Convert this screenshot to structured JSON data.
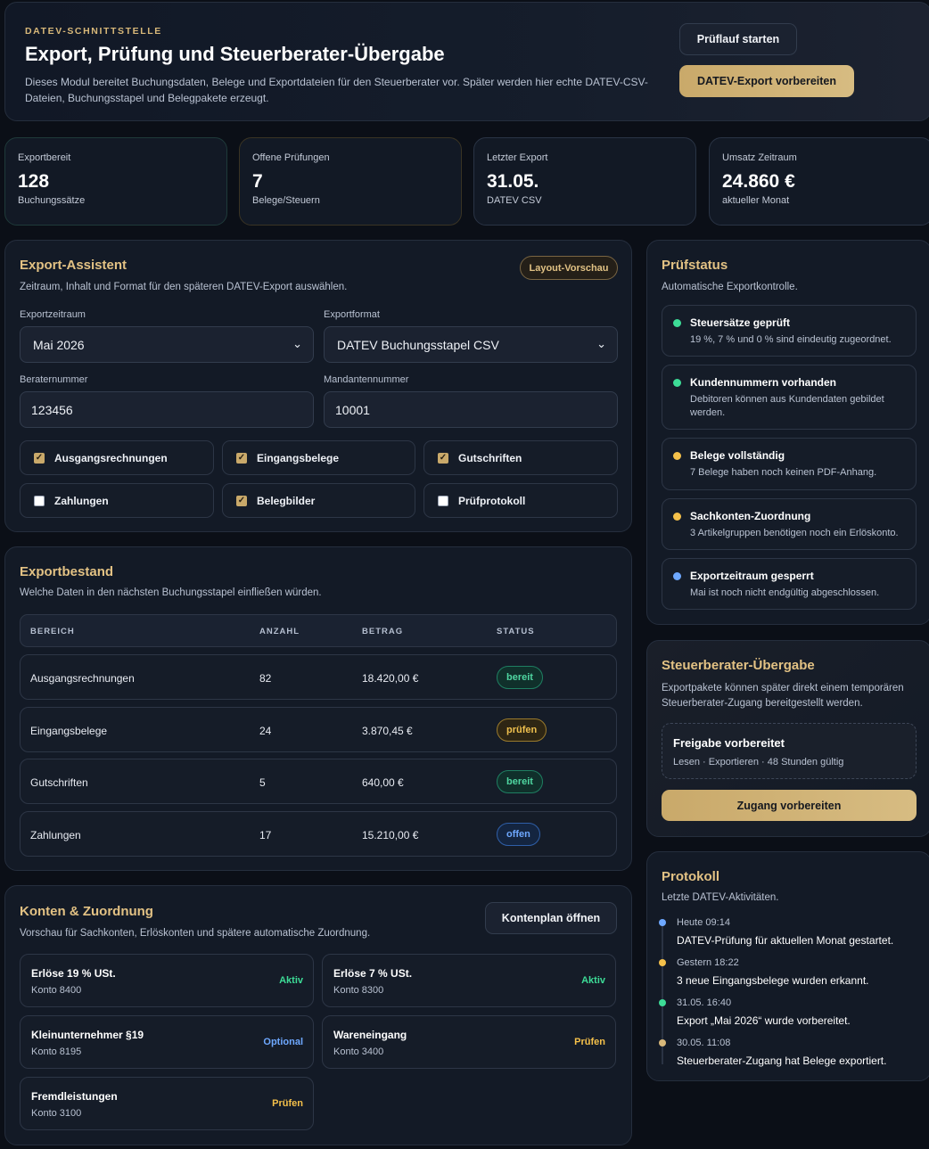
{
  "header": {
    "kicker": "DATEV-SCHNITTSTELLE",
    "title": "Export, Prüfung und Steuerberater-Übergabe",
    "description": "Dieses Modul bereitet Buchungsdaten, Belege und Exportdateien für den Steuerberater vor. Später werden hier echte DATEV-CSV-Dateien, Buchungsstapel und Belegpakete erzeugt.",
    "check_button": "Prüflauf starten",
    "export_button": "DATEV-Export vorbereiten"
  },
  "stats": [
    {
      "label": "Exportbereit",
      "value": "128",
      "sub": "Buchungssätze"
    },
    {
      "label": "Offene Prüfungen",
      "value": "7",
      "sub": "Belege/Steuern"
    },
    {
      "label": "Letzter Export",
      "value": "31.05.",
      "sub": "DATEV CSV"
    },
    {
      "label": "Umsatz Zeitraum",
      "value": "24.860 €",
      "sub": "aktueller Monat"
    }
  ],
  "assistant": {
    "title": "Export-Assistent",
    "subtitle": "Zeitraum, Inhalt und Format für den späteren DATEV-Export auswählen.",
    "badge": "Layout-Vorschau",
    "period_label": "Exportzeitraum",
    "period_value": "Mai 2026",
    "format_label": "Exportformat",
    "format_value": "DATEV Buchungsstapel CSV",
    "advisor_label": "Beraternummer",
    "advisor_value": "123456",
    "client_label": "Mandantennummer",
    "client_value": "10001",
    "options": [
      {
        "label": "Ausgangsrechnungen",
        "checked": true
      },
      {
        "label": "Eingangsbelege",
        "checked": true
      },
      {
        "label": "Gutschriften",
        "checked": true
      },
      {
        "label": "Zahlungen",
        "checked": false
      },
      {
        "label": "Belegbilder",
        "checked": true
      },
      {
        "label": "Prüfprotokoll",
        "checked": false
      }
    ]
  },
  "inventory": {
    "title": "Exportbestand",
    "subtitle": "Welche Daten in den nächsten Buchungsstapel einfließen würden.",
    "columns": [
      "BEREICH",
      "ANZAHL",
      "BETRAG",
      "STATUS"
    ],
    "rows": [
      {
        "area": "Ausgangsrechnungen",
        "count": "82",
        "amount": "18.420,00 €",
        "status": "bereit"
      },
      {
        "area": "Eingangsbelege",
        "count": "24",
        "amount": "3.870,45 €",
        "status": "prüfen"
      },
      {
        "area": "Gutschriften",
        "count": "5",
        "amount": "640,00 €",
        "status": "bereit"
      },
      {
        "area": "Zahlungen",
        "count": "17",
        "amount": "15.210,00 €",
        "status": "offen"
      }
    ]
  },
  "accounts": {
    "title": "Konten & Zuordnung",
    "subtitle": "Vorschau für Sachkonten, Erlöskonten und spätere automatische Zuordnung.",
    "button": "Kontenplan öffnen",
    "items": [
      {
        "name": "Erlöse 19 % USt.",
        "account": "Konto 8400",
        "status": "Aktiv"
      },
      {
        "name": "Erlöse 7 % USt.",
        "account": "Konto 8300",
        "status": "Aktiv"
      },
      {
        "name": "Kleinunternehmer §19",
        "account": "Konto 8195",
        "status": "Optional"
      },
      {
        "name": "Wareneingang",
        "account": "Konto 3400",
        "status": "Prüfen"
      },
      {
        "name": "Fremdleistungen",
        "account": "Konto 3100",
        "status": "Prüfen"
      }
    ]
  },
  "check_status": {
    "title": "Prüfstatus",
    "subtitle": "Automatische Exportkontrolle.",
    "items": [
      {
        "title": "Steuersätze geprüft",
        "desc": "19 %, 7 % und 0 % sind eindeutig zugeordnet.",
        "color": "#3ddc97"
      },
      {
        "title": "Kundennummern vorhanden",
        "desc": "Debitoren können aus Kundendaten gebildet werden.",
        "color": "#3ddc97"
      },
      {
        "title": "Belege vollständig",
        "desc": "7 Belege haben noch keinen PDF-Anhang.",
        "color": "#f4c04a"
      },
      {
        "title": "Sachkonten-Zuordnung",
        "desc": "3 Artikelgruppen benötigen noch ein Erlöskonto.",
        "color": "#f4c04a"
      },
      {
        "title": "Exportzeitraum gesperrt",
        "desc": "Mai ist noch nicht endgültig abgeschlossen.",
        "color": "#6ea8ff"
      }
    ]
  },
  "handover": {
    "title": "Steuerberater-Übergabe",
    "subtitle": "Exportpakete können später direkt einem temporären Steuerberater-Zugang bereitgestellt werden.",
    "box_title": "Freigabe vorbereitet",
    "box_desc": "Lesen · Exportieren · 48 Stunden gültig",
    "button": "Zugang vorbereiten"
  },
  "log": {
    "title": "Protokoll",
    "subtitle": "Letzte DATEV-Aktivitäten.",
    "entries": [
      {
        "time": "Heute 09:14",
        "msg": "DATEV-Prüfung für aktuellen Monat gestartet.",
        "color": "#6ea8ff"
      },
      {
        "time": "Gestern 18:22",
        "msg": "3 neue Eingangsbelege wurden erkannt.",
        "color": "#f4c04a"
      },
      {
        "time": "31.05. 16:40",
        "msg": "Export „Mai 2026“ wurde vorbereitet.",
        "color": "#3ddc97"
      },
      {
        "time": "30.05. 11:08",
        "msg": "Steuerberater-Zugang hat Belege exportiert.",
        "color": "#d8b879"
      }
    ]
  }
}
